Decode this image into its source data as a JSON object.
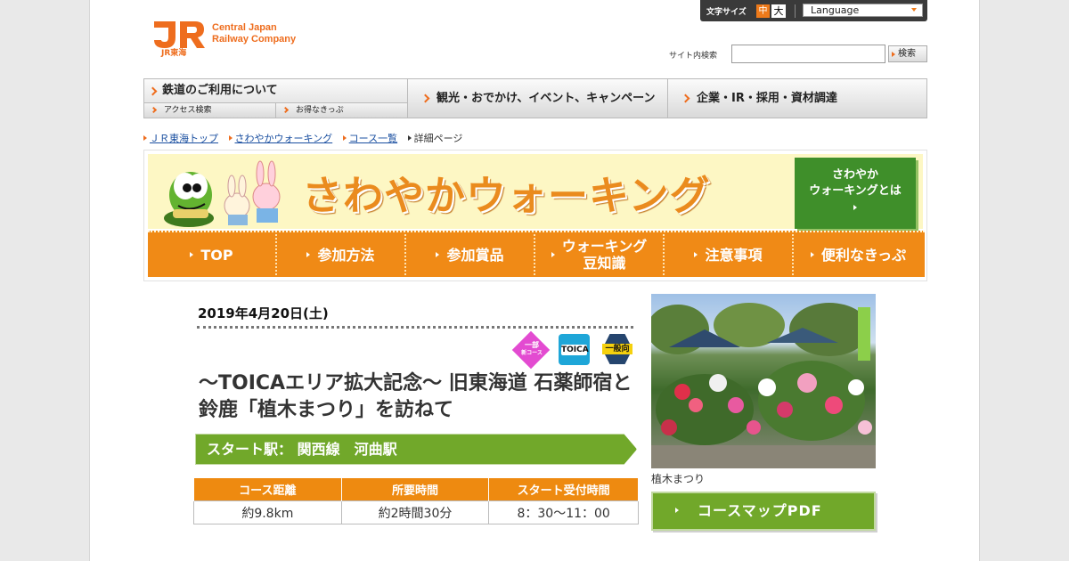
{
  "header": {
    "logo_mark": "JR",
    "logo_sub": "JR東海",
    "company_line1": "Central Japan",
    "company_line2": "Railway Company",
    "font_size_label": "文字サイズ",
    "font_size_mid": "中",
    "font_size_large": "大",
    "language": "Language",
    "search_label": "サイト内検索",
    "search_value": "",
    "search_button": "検索"
  },
  "gnav": {
    "railway": "鉄道のご利用について",
    "access": "アクセス検索",
    "tickets": "お得なきっぷ",
    "tourism": "観光・おでかけ、イベント、キャンペーン",
    "corporate": "企業・IR・採用・資材調達"
  },
  "breadcrumb": [
    "ＪＲ東海トップ",
    "さわやかウォーキング",
    "コース一覧",
    "詳細ページ"
  ],
  "banner": {
    "title": "さわやかウォーキング",
    "about_line1": "さわやか",
    "about_line2": "ウォーキングとは"
  },
  "menu": [
    {
      "label": "TOP"
    },
    {
      "label": "参加方法"
    },
    {
      "label": "参加賞品"
    },
    {
      "label1": "ウォーキング",
      "label2": "豆知識"
    },
    {
      "label": "注意事項"
    },
    {
      "label": "便利なきっぷ"
    }
  ],
  "course": {
    "date": "2019年4月20日(土)",
    "badge_new_1": "一部",
    "badge_new_2": "新コース",
    "badge_toica": "TOICA",
    "badge_general": "一般向",
    "title": "～TOICAエリア拡大記念～ 旧東海道 石薬師宿と鈴鹿「植木まつり」を訪ねて",
    "start_station": "スタート駅： 関西線　河曲駅",
    "table_headers": [
      "コース距離",
      "所要時間",
      "スタート受付時間"
    ],
    "table_values": [
      "約9.8km",
      "約2時間30分",
      "8：30～11：00"
    ],
    "photo_caption": "植木まつり",
    "pdf_button": "コースマップPDF"
  },
  "colors": {
    "brand_orange": "#ee6d1e",
    "menu_orange": "#f08a16",
    "green": "#71a82a",
    "dark_green": "#3f8f2a"
  }
}
